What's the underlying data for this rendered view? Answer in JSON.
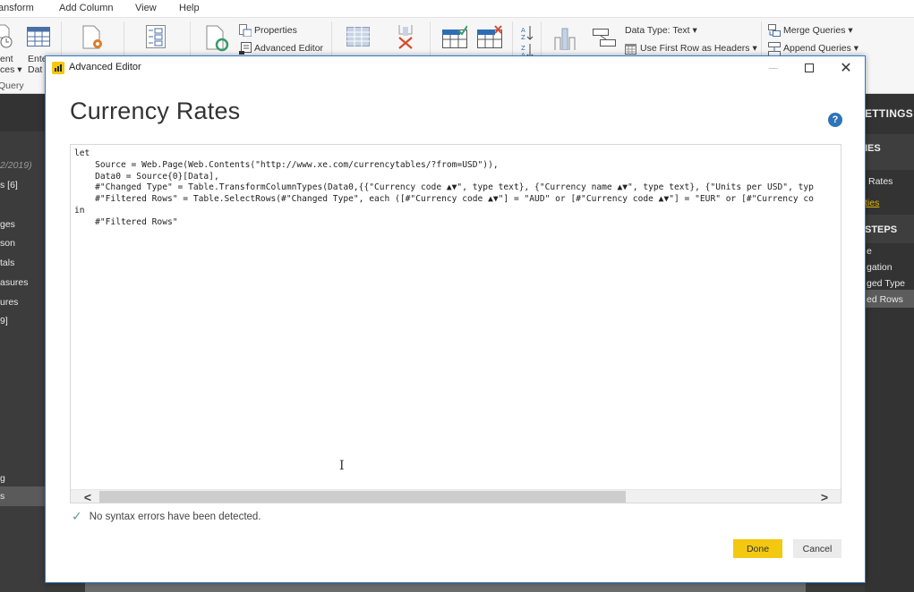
{
  "menubar": {
    "items": [
      "ansform",
      "Add Column",
      "View",
      "Help"
    ]
  },
  "ribbon": {
    "recent_sources": [
      "ent",
      "ces ▾"
    ],
    "enter_data": [
      "Ente",
      "Dat"
    ],
    "group_query": "Query",
    "properties": "Properties",
    "advanced_editor": "Advanced Editor",
    "data_type": "Data Type: Text ▾",
    "use_first_row": "Use First Row as Headers ▾",
    "merge_queries": "Merge Queries ▾",
    "append_queries": "Append Queries ▾"
  },
  "left_panel": {
    "items": [
      {
        "label": "2/2019)",
        "dim": true
      },
      {
        "label": "s [6]",
        "dim": false
      },
      {
        "label": "ges",
        "dim": false
      },
      {
        "label": "son",
        "dim": false
      },
      {
        "label": "tals",
        "dim": false
      },
      {
        "label": "asures",
        "dim": false
      },
      {
        "label": "ures",
        "dim": false
      },
      {
        "label": "9]",
        "dim": false
      },
      {
        "label": "g",
        "dim": false
      },
      {
        "label": "s",
        "dim": false
      }
    ]
  },
  "right_panel": {
    "title": "ETTINGS",
    "section_properties": "IES",
    "name_value": "Rates",
    "all_properties_link": "ties",
    "section_steps": "STEPS",
    "steps": [
      "e",
      "gation",
      "ged Type",
      "ed Rows"
    ]
  },
  "dialog": {
    "window_title": "Advanced Editor",
    "query_name": "Currency Rates",
    "help_icon": "?",
    "code_lines": [
      "let",
      "    Source = Web.Page(Web.Contents(\"http://www.xe.com/currencytables/?from=USD\")),",
      "    Data0 = Source{0}[Data],",
      "    #\"Changed Type\" = Table.TransformColumnTypes(Data0,{{\"Currency code ▲▼\", type text}, {\"Currency name ▲▼\", type text}, {\"Units per USD\", typ",
      "    #\"Filtered Rows\" = Table.SelectRows(#\"Changed Type\", each ([#\"Currency code ▲▼\"] = \"AUD\" or [#\"Currency code ▲▼\"] = \"EUR\" or [#\"Currency co",
      "in",
      "    #\"Filtered Rows\""
    ],
    "scroll_left": "<",
    "scroll_right": ">",
    "status_message": "No syntax errors have been detected.",
    "done_label": "Done",
    "cancel_label": "Cancel",
    "accent_color": "#f2c811"
  }
}
